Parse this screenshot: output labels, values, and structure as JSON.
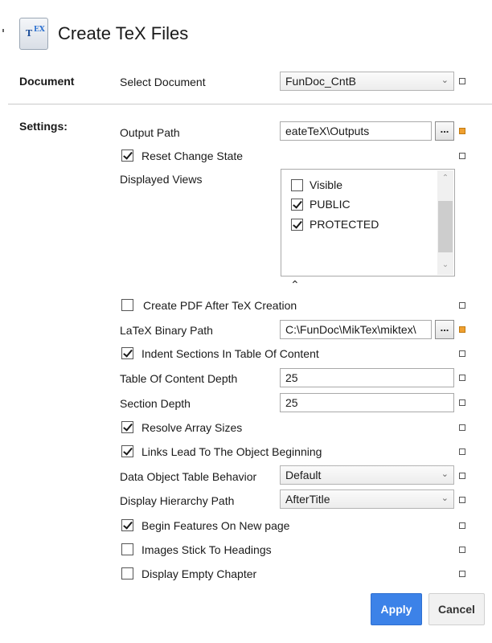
{
  "window": {
    "title": "Create TeX Files",
    "icon": "tex-document-icon",
    "icon_text": "T",
    "icon_sup": "EX"
  },
  "document_section": {
    "label": "Document",
    "select_label": "Select Document",
    "selected_document": "FunDoc_CntB"
  },
  "settings_section": {
    "label": "Settings:",
    "output_path": {
      "label": "Output Path",
      "value": "eateTeX\\Outputs"
    },
    "reset_change_state": {
      "label": "Reset Change State",
      "checked": true
    },
    "displayed_views": {
      "label": "Displayed Views",
      "items": [
        {
          "label": "Visible",
          "checked": false
        },
        {
          "label": "PUBLIC",
          "checked": true
        },
        {
          "label": "PROTECTED",
          "checked": true
        }
      ]
    },
    "create_pdf": {
      "label": "Create PDF After TeX Creation",
      "checked": false
    },
    "latex_binary_path": {
      "label": "LaTeX Binary Path",
      "value": "C:\\FunDoc\\MikTex\\miktex\\"
    },
    "indent_sections": {
      "label": "Indent Sections In Table Of Content",
      "checked": true
    },
    "toc_depth": {
      "label": "Table Of Content Depth",
      "value": "25"
    },
    "section_depth": {
      "label": "Section Depth",
      "value": "25"
    },
    "resolve_array_sizes": {
      "label": "Resolve Array Sizes",
      "checked": true
    },
    "links_lead": {
      "label": "Links Lead To The Object Beginning",
      "checked": true
    },
    "data_object_table_behavior": {
      "label": "Data Object Table Behavior",
      "value": "Default"
    },
    "display_hierarchy_path": {
      "label": "Display Hierarchy Path",
      "value": "AfterTitle"
    },
    "begin_features": {
      "label": "Begin Features On New page",
      "checked": true
    },
    "images_stick": {
      "label": "Images Stick To Headings",
      "checked": false
    },
    "display_empty_chapter": {
      "label": "Display Empty Chapter",
      "checked": false
    }
  },
  "glyphs": {
    "chevron_down": "⌄",
    "chevron_up": "⌃",
    "collapse": "⌃",
    "browse": "..."
  },
  "buttons": {
    "apply": "Apply",
    "cancel": "Cancel"
  },
  "colors": {
    "accent": "#3c82e8",
    "dirty_marker": "#f0a030"
  }
}
